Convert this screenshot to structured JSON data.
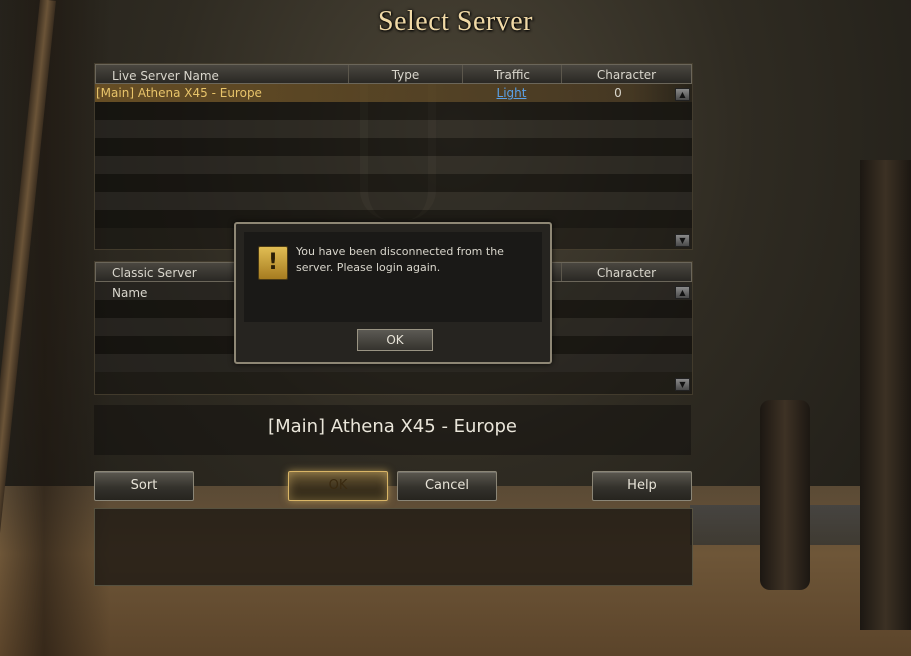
{
  "title": "Select Server",
  "live_list": {
    "columns": [
      "Live Server Name",
      "Type",
      "Traffic",
      "Character"
    ],
    "rows": [
      {
        "name": "[Main] Athena X45 - Europe",
        "type": "",
        "traffic": "Light",
        "character": "0"
      }
    ]
  },
  "classic_list": {
    "columns": [
      "Classic Server Name",
      "Character"
    ]
  },
  "selected_server": "[Main] Athena X45 - Europe",
  "buttons": {
    "sort": "Sort",
    "ok": "OK",
    "cancel": "Cancel",
    "help": "Help"
  },
  "dialog": {
    "message": "You have been disconnected from the server. Please login again.",
    "ok": "OK",
    "icon": "warning-icon"
  },
  "colors": {
    "title": "#f0d9a6",
    "selected_row_text": "#e8c46a",
    "traffic_light": "#5aa0e6",
    "gold_button_border": "#d9b566"
  }
}
